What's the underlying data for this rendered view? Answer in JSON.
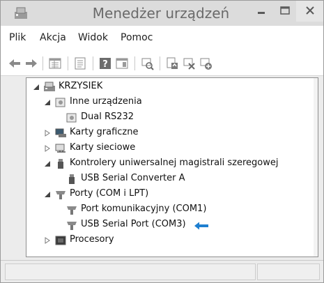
{
  "window": {
    "title": "Menedżer urządzeń"
  },
  "menubar": {
    "items": [
      "Plik",
      "Akcja",
      "Widok",
      "Pomoc"
    ]
  },
  "toolbar": {
    "icons": [
      "back-arrow-icon",
      "forward-arrow-icon",
      "properties-grid-icon",
      "document-icon",
      "help-icon",
      "properties-panel-icon",
      "scan-hardware-icon",
      "update-driver-icon",
      "disable-device-icon",
      "uninstall-device-icon"
    ]
  },
  "tree": {
    "root": "KRZYSIEK",
    "items": [
      {
        "label": "Inne urządzenia",
        "icon": "unknown-device-icon",
        "expanded": true
      },
      {
        "label": "Dual RS232",
        "icon": "unknown-device-icon"
      },
      {
        "label": "Karty graficzne",
        "icon": "display-adapter-icon",
        "expanded": false
      },
      {
        "label": "Karty sieciowe",
        "icon": "network-adapter-icon",
        "expanded": false
      },
      {
        "label": "Kontrolery uniwersalnej magistrali szeregowej",
        "icon": "usb-icon",
        "expanded": true
      },
      {
        "label": "USB Serial Converter A",
        "icon": "usb-icon"
      },
      {
        "label": "Porty (COM i LPT)",
        "icon": "port-icon",
        "expanded": true
      },
      {
        "label": "Port komunikacyjny (COM1)",
        "icon": "port-icon"
      },
      {
        "label": "USB Serial Port (COM3)",
        "icon": "port-icon",
        "highlighted": true
      },
      {
        "label": "Procesory",
        "icon": "processor-icon",
        "expanded": false
      }
    ]
  },
  "colors": {
    "arrow": "#1e7fd0",
    "titlebar": "#dcdcdc",
    "title_text": "#6a6a6a"
  }
}
